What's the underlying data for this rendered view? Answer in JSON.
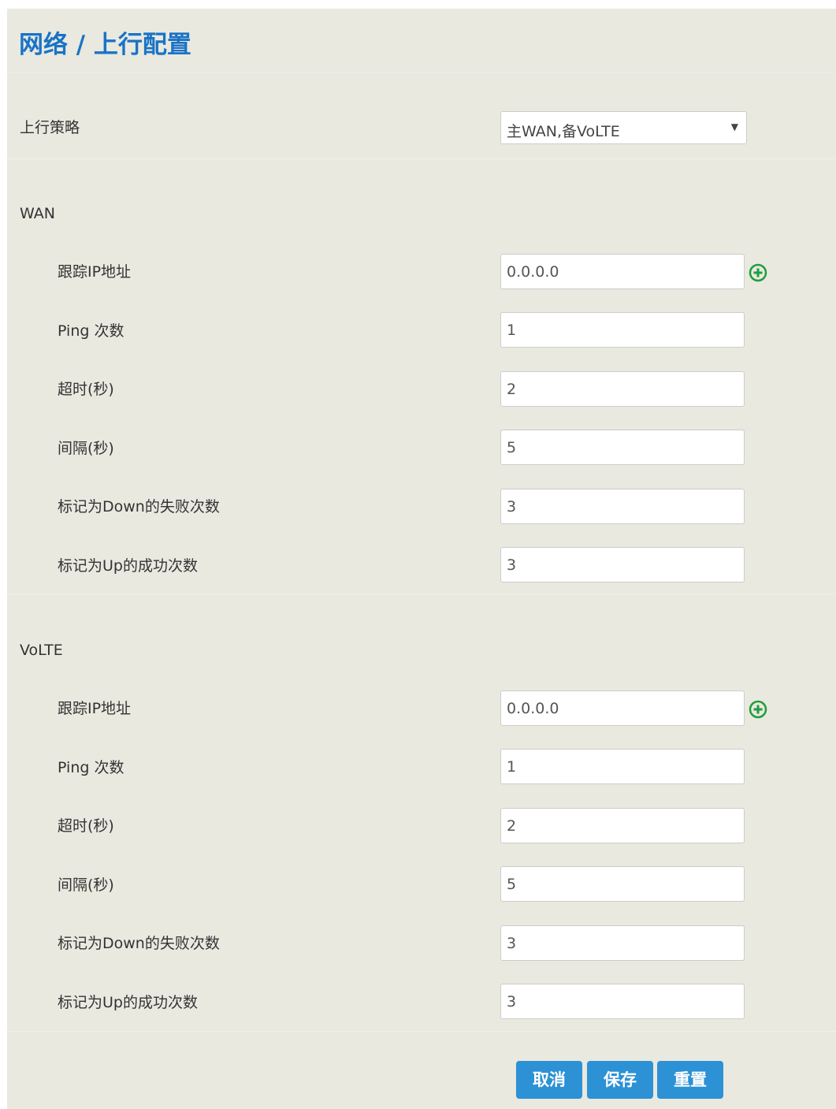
{
  "header": {
    "title": "网络 / 上行配置"
  },
  "policy": {
    "label": "上行策略",
    "selected": "主WAN,备VoLTE"
  },
  "wan": {
    "title": "WAN",
    "track_ip": {
      "label": "跟踪IP地址",
      "value": "0.0.0.0"
    },
    "ping_count": {
      "label": "Ping 次数",
      "value": "1"
    },
    "timeout": {
      "label": "超时(秒)",
      "value": "2"
    },
    "interval": {
      "label": "间隔(秒)",
      "value": "5"
    },
    "down_fail_count": {
      "label": "标记为Down的失败次数",
      "value": "3"
    },
    "up_success_count": {
      "label": "标记为Up的成功次数",
      "value": "3"
    }
  },
  "volte": {
    "title": "VoLTE",
    "track_ip": {
      "label": "跟踪IP地址",
      "value": "0.0.0.0"
    },
    "ping_count": {
      "label": "Ping 次数",
      "value": "1"
    },
    "timeout": {
      "label": "超时(秒)",
      "value": "2"
    },
    "interval": {
      "label": "间隔(秒)",
      "value": "5"
    },
    "down_fail_count": {
      "label": "标记为Down的失败次数",
      "value": "3"
    },
    "up_success_count": {
      "label": "标记为Up的成功次数",
      "value": "3"
    }
  },
  "buttons": {
    "cancel": "取消",
    "save": "保存",
    "reset": "重置"
  },
  "colors": {
    "title": "#1a73c6",
    "button": "#2c91d5",
    "add_icon": "#1e9e3e",
    "panel": "#e9e9e0"
  },
  "icons": {
    "add": "plus-circle-icon",
    "dropdown": "caret-down-icon"
  }
}
